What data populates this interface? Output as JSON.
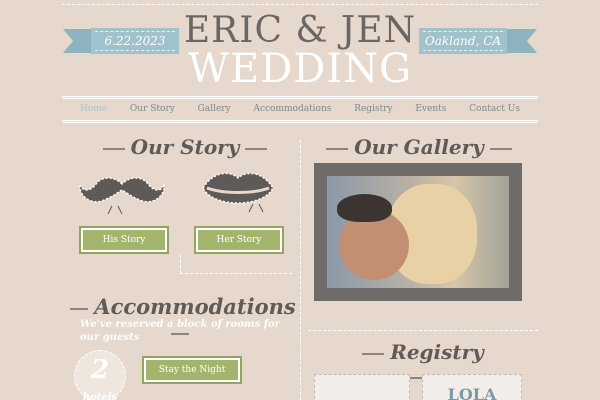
{
  "header": {
    "date": "6.22.2023",
    "title_line1": "ERIC & JEN",
    "title_line2": "WEDDING",
    "location": "Oakland, CA"
  },
  "nav": {
    "items": [
      "Home",
      "Our Story",
      "Gallery",
      "Accommodations",
      "Registry",
      "Events",
      "Contact Us"
    ]
  },
  "story": {
    "heading": "Our Story",
    "his_button": "His Story",
    "her_button": "Her Story"
  },
  "gallery": {
    "heading": "Our Gallery"
  },
  "accommodations": {
    "heading": "Accommodations",
    "text": "We've reserved a block of rooms for our guests",
    "count": "2",
    "count_label": "hotels",
    "button": "Stay the Night"
  },
  "registry": {
    "heading": "Registry",
    "card2_text": "LOLA"
  },
  "colors": {
    "background": "#e6d8cc",
    "ribbon": "#9fc2cc",
    "button": "#a3b56d",
    "heading": "#5f5b59"
  }
}
